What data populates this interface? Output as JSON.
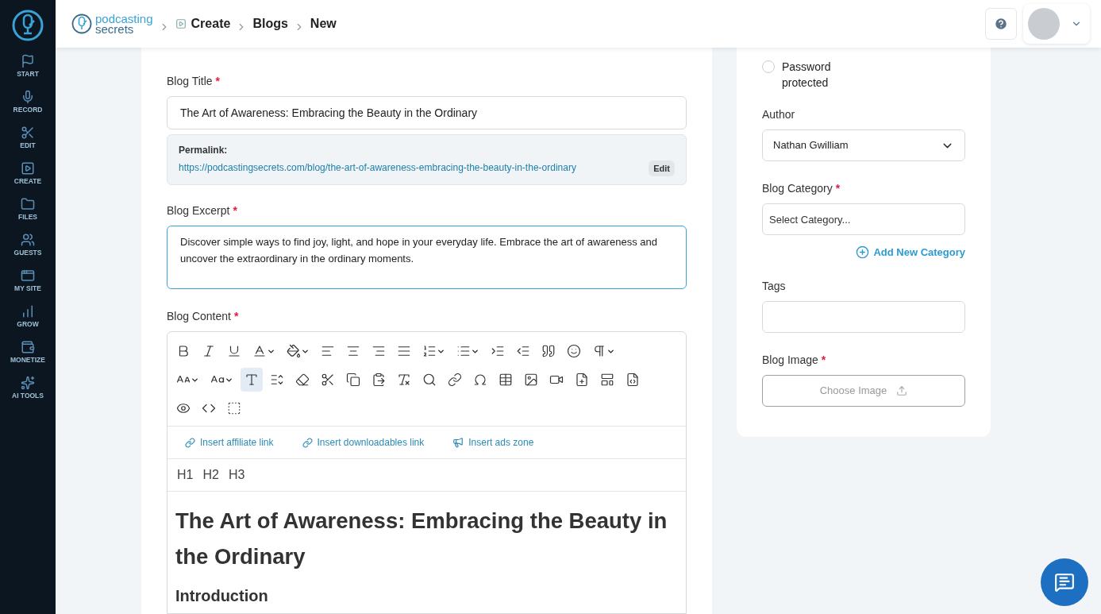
{
  "sidebar": {
    "items": [
      {
        "label": "START",
        "kind": "start"
      },
      {
        "label": "RECORD",
        "kind": "record"
      },
      {
        "label": "EDIT",
        "kind": "edit"
      },
      {
        "label": "CREATE",
        "kind": "create"
      },
      {
        "label": "FILES",
        "kind": "files"
      },
      {
        "label": "GUESTS",
        "kind": "guests"
      },
      {
        "label": "MY SITE",
        "kind": "site"
      },
      {
        "label": "GROW",
        "kind": "grow"
      },
      {
        "label": "MONETIZE",
        "kind": "monetize"
      },
      {
        "label": "AI TOOLS",
        "kind": "ai"
      }
    ]
  },
  "header": {
    "logo": [
      "podcasting",
      "secrets"
    ],
    "breadcrumbs": [
      "Create",
      "Blogs",
      "New"
    ]
  },
  "form": {
    "title": {
      "label": "Blog Title",
      "required_mark": "*",
      "value": "The Art of Awareness: Embracing the Beauty in the Ordinary"
    },
    "permalink": {
      "label": "Permalink:",
      "url": "https://podcastingsecrets.com/blog/the-art-of-awareness-embracing-the-beauty-in-the-ordinary",
      "button": "Edit"
    },
    "excerpt": {
      "label": "Blog Excerpt",
      "required_mark": "*",
      "value": "Discover simple ways to find joy, light, and hope in your everyday life. Embrace the art of awareness and uncover the extraordinary in the ordinary moments."
    },
    "content": {
      "label": "Blog Content",
      "required_mark": "*",
      "add_text_active": true,
      "insert_links": [
        {
          "label": "Insert affiliate link",
          "kind": "link"
        },
        {
          "label": "Insert downloadables link",
          "kind": "link"
        },
        {
          "label": "Insert ads zone",
          "kind": "ads"
        }
      ],
      "headings": [
        "H1",
        "H2",
        "H3"
      ],
      "body": [
        {
          "kind": "h1",
          "text": "The Art of Awareness: Embracing the Beauty in the Ordinary"
        },
        {
          "kind": "h2",
          "text": "Introduction"
        }
      ]
    }
  },
  "settings": {
    "visibility": [
      {
        "label": "Password protected",
        "selected": false
      }
    ],
    "author": {
      "label": "Author",
      "value": "Nathan Gwilliam"
    },
    "category": {
      "label": "Blog Category",
      "required_mark": "*",
      "placeholder": "Select Category...",
      "add": "Add New Category"
    },
    "tags": {
      "label": "Tags"
    },
    "image": {
      "label": "Blog Image",
      "required_mark": "*",
      "button": "Choose Image"
    }
  }
}
